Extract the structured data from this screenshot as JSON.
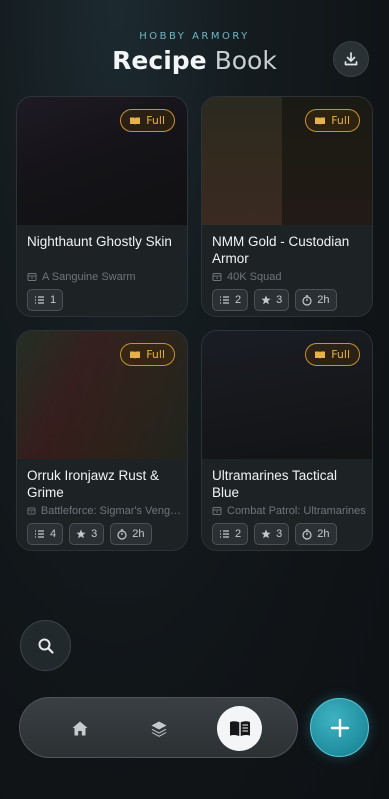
{
  "header": {
    "subtitle": "HOBBY ARMORY",
    "title_bold": "Recipe",
    "title_light": "Book"
  },
  "cards": [
    {
      "title": "Nighthaunt Ghostly Skin",
      "subtitle": "A Sanguine Swarm",
      "badge": "Full",
      "swatches": [
        "#4a3a7a"
      ],
      "chips": [
        {
          "icon": "list-icon",
          "label": "1"
        }
      ]
    },
    {
      "title": "NMM Gold - Custodian Armor",
      "subtitle": "40K Squad",
      "badge": "Full",
      "swatches": [
        "#c8ae6a",
        "#6a1a22"
      ],
      "chips": [
        {
          "icon": "list-icon",
          "label": "2"
        },
        {
          "icon": "star-icon",
          "label": "3"
        },
        {
          "icon": "timer-icon",
          "label": "2h"
        }
      ]
    },
    {
      "title": "Orruk Ironjawz Rust & Grime",
      "subtitle": "Battleforce: Sigmar's Vengeance",
      "badge": "Full",
      "swatches": [
        "#3a8a5a",
        "#8a2a2a",
        "#b0542a",
        "#4a6a2a"
      ],
      "chips": [
        {
          "icon": "list-icon",
          "label": "4"
        },
        {
          "icon": "star-icon",
          "label": "3"
        },
        {
          "icon": "timer-icon",
          "label": "2h"
        }
      ]
    },
    {
      "title": "Ultramarines Tactical Blue",
      "subtitle": "Combat Patrol: Ultramarines",
      "badge": "Full",
      "swatches": [
        "#1e3a8a",
        "#141618"
      ],
      "chips": [
        {
          "icon": "list-icon",
          "label": "2"
        },
        {
          "icon": "star-icon",
          "label": "3"
        },
        {
          "icon": "timer-icon",
          "label": "2h"
        }
      ]
    }
  ],
  "nav": {
    "items": [
      "home-icon",
      "layers-icon",
      "book-icon"
    ],
    "active": "book-icon"
  },
  "colors": {
    "accent": "#2aa3b4",
    "badge": "#e6b04a"
  }
}
